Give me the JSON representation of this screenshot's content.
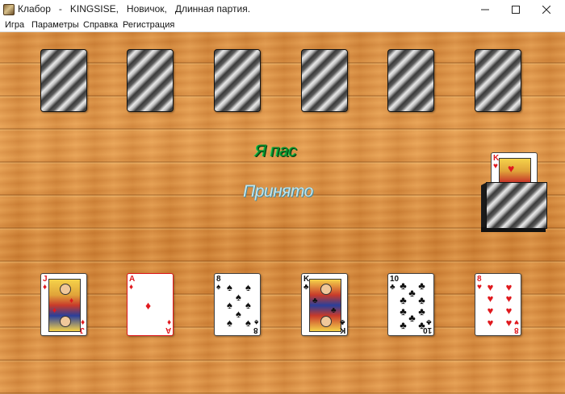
{
  "window": {
    "title": "Клабор   -   KINGSISE,   Новичок,   Длинная партия.",
    "controls": [
      "minimize",
      "maximize",
      "close"
    ]
  },
  "menu": {
    "items": [
      {
        "label": "Игра"
      },
      {
        "label": "Параметры"
      },
      {
        "label": "Справка"
      },
      {
        "label": "Регистрация"
      }
    ]
  },
  "opponent": {
    "hand_count": 6,
    "card_back_icon": "striped-card-back"
  },
  "messages": {
    "opponent_bid": "Я пас",
    "status": "Принято"
  },
  "trump_card": {
    "rank": "K",
    "suit": "♥",
    "color": "#e0191e"
  },
  "deck": {
    "icon": "card-deck-icon"
  },
  "player_hand": [
    {
      "rank": "J",
      "suit": "♦",
      "color": "red",
      "kind": "face"
    },
    {
      "rank": "A",
      "suit": "♦",
      "color": "red",
      "kind": "ace"
    },
    {
      "rank": "8",
      "suit": "♠",
      "color": "black",
      "kind": "pips"
    },
    {
      "rank": "K",
      "suit": "♣",
      "color": "black",
      "kind": "face"
    },
    {
      "rank": "10",
      "suit": "♣",
      "color": "black",
      "kind": "pips"
    },
    {
      "rank": "8",
      "suit": "♥",
      "color": "red",
      "kind": "pips"
    }
  ],
  "colors": {
    "table": "#e09445",
    "red_suit": "#e0191e",
    "black_suit": "#111111",
    "pass_text": "#0a8a2a",
    "accepted_text": "#bfe6f0"
  }
}
